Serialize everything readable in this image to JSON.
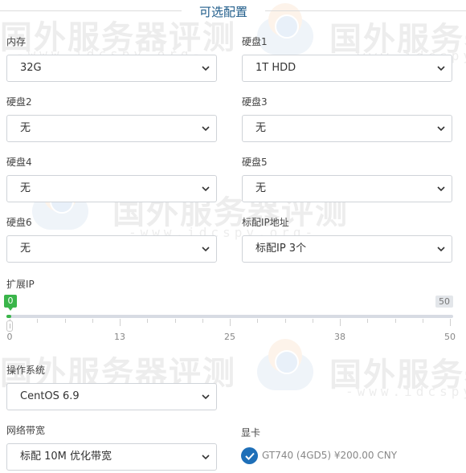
{
  "section_title": "可选配置",
  "fields": {
    "ram": {
      "label": "内存",
      "value": "32G"
    },
    "disk1": {
      "label": "硬盘1",
      "value": "1T HDD"
    },
    "disk2": {
      "label": "硬盘2",
      "value": "无"
    },
    "disk3": {
      "label": "硬盘3",
      "value": "无"
    },
    "disk4": {
      "label": "硬盘4",
      "value": "无"
    },
    "disk5": {
      "label": "硬盘5",
      "value": "无"
    },
    "disk6": {
      "label": "硬盘6",
      "value": "无"
    },
    "ip": {
      "label": "标配IP地址",
      "value": "标配IP 3个"
    },
    "os": {
      "label": "操作系统",
      "value": "CentOS 6.9"
    },
    "bandwidth": {
      "label": "网络带宽",
      "value": "标配 10M 优化带宽"
    }
  },
  "extra_ip": {
    "label": "扩展IP",
    "min": 0,
    "max": 50,
    "value": 0,
    "min_label": "0",
    "max_label": "50",
    "tick_labels": [
      "0",
      "13",
      "25",
      "38",
      "50"
    ]
  },
  "gpu": {
    "label": "显卡",
    "option": "GT740 (4GD5) ¥200.00 CNY",
    "checked": true
  },
  "watermark": {
    "title": "国外服务器评测",
    "url": "-www.idcspy.org-"
  },
  "colors": {
    "accent_green": "#3ab54a",
    "check_blue": "#1e6fb8",
    "title_blue": "#1f5c8a"
  }
}
